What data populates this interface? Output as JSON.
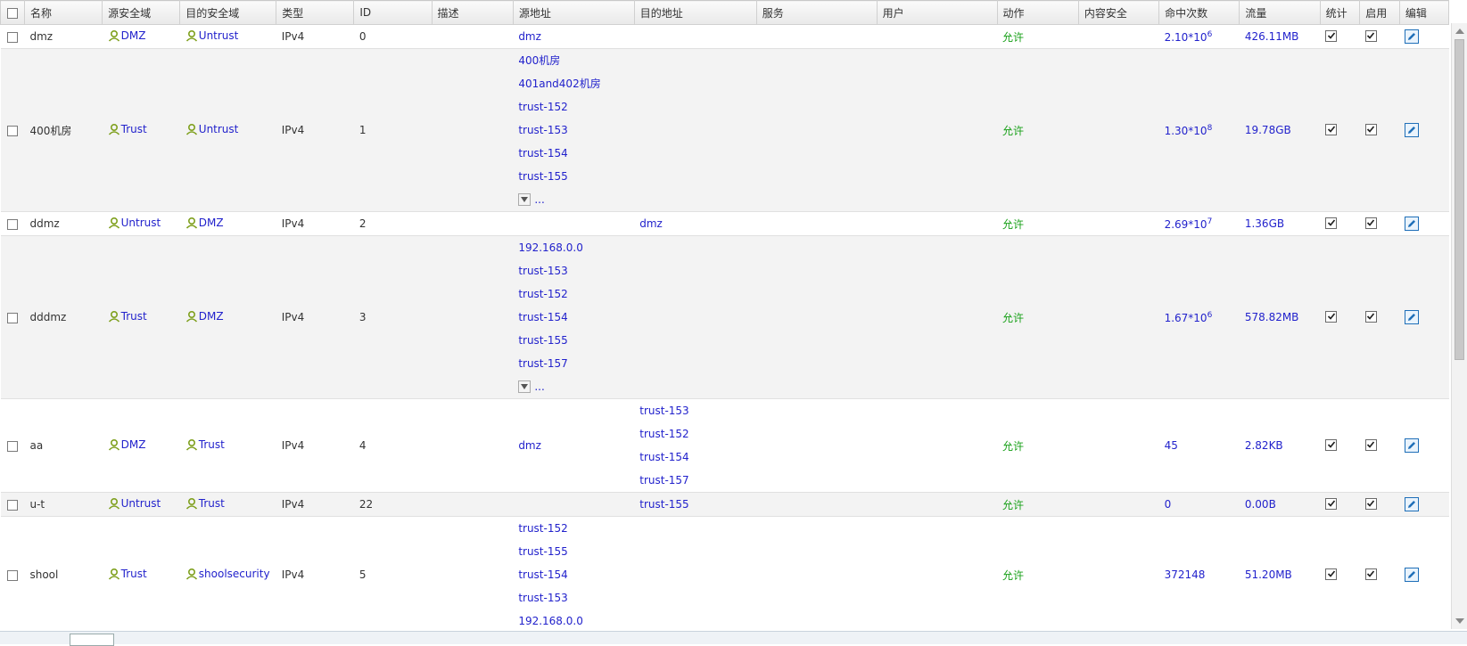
{
  "columns": {
    "name": "名称",
    "src_zone": "源安全域",
    "dst_zone": "目的安全域",
    "type": "类型",
    "id": "ID",
    "desc": "描述",
    "src_addr": "源地址",
    "dst_addr": "目的地址",
    "service": "服务",
    "user": "用户",
    "action": "动作",
    "content_security": "内容安全",
    "hits": "命中次数",
    "traffic": "流量",
    "stats": "统计",
    "enable": "启用",
    "edit": "编辑"
  },
  "rows": [
    {
      "name": "dmz",
      "src_zone": "DMZ",
      "dst_zone": "Untrust",
      "type": "IPv4",
      "id": "0",
      "src_addr": [
        "dmz"
      ],
      "src_more": false,
      "dst_addr": [],
      "action": "允许",
      "hits_base": "2.10*10",
      "hits_exp": "6",
      "traffic": "426.11MB",
      "stats": true,
      "enable": true
    },
    {
      "name": "400机房",
      "src_zone": "Trust",
      "dst_zone": "Untrust",
      "type": "IPv4",
      "id": "1",
      "src_addr": [
        "400机房",
        "401and402机房",
        "trust-152",
        "trust-153",
        "trust-154",
        "trust-155"
      ],
      "src_more": true,
      "dst_addr": [],
      "action": "允许",
      "hits_base": "1.30*10",
      "hits_exp": "8",
      "traffic": "19.78GB",
      "stats": true,
      "enable": true
    },
    {
      "name": "ddmz",
      "src_zone": "Untrust",
      "dst_zone": "DMZ",
      "type": "IPv4",
      "id": "2",
      "src_addr": [],
      "src_more": false,
      "dst_addr": [
        "dmz"
      ],
      "action": "允许",
      "hits_base": "2.69*10",
      "hits_exp": "7",
      "traffic": "1.36GB",
      "stats": true,
      "enable": true
    },
    {
      "name": "dddmz",
      "src_zone": "Trust",
      "dst_zone": "DMZ",
      "type": "IPv4",
      "id": "3",
      "src_addr": [
        "192.168.0.0",
        "trust-153",
        "trust-152",
        "trust-154",
        "trust-155",
        "trust-157"
      ],
      "src_more": true,
      "dst_addr": [],
      "action": "允许",
      "hits_base": "1.67*10",
      "hits_exp": "6",
      "traffic": "578.82MB",
      "stats": true,
      "enable": true
    },
    {
      "name": "aa",
      "src_zone": "DMZ",
      "dst_zone": "Trust",
      "type": "IPv4",
      "id": "4",
      "src_addr": [
        "dmz"
      ],
      "src_more": false,
      "dst_addr": [
        "trust-153",
        "trust-152",
        "trust-154",
        "trust-157"
      ],
      "action": "允许",
      "hits_base": "45",
      "hits_exp": "",
      "traffic": "2.82KB",
      "stats": true,
      "enable": true
    },
    {
      "name": "u-t",
      "src_zone": "Untrust",
      "dst_zone": "Trust",
      "type": "IPv4",
      "id": "22",
      "src_addr": [],
      "src_more": false,
      "dst_addr": [
        "trust-155"
      ],
      "action": "允许",
      "hits_base": "0",
      "hits_exp": "",
      "traffic": "0.00B",
      "stats": true,
      "enable": true
    },
    {
      "name": "shool",
      "src_zone": "Trust",
      "dst_zone": "shoolsecurity",
      "type": "IPv4",
      "id": "5",
      "src_addr": [
        "trust-152",
        "trust-155",
        "trust-154",
        "trust-153",
        "192.168.0.0"
      ],
      "src_more": false,
      "dst_addr": [],
      "action": "允许",
      "hits_base": "372148",
      "hits_exp": "",
      "traffic": "51.20MB",
      "stats": true,
      "enable": true
    }
  ],
  "icons": {
    "zone": "zone-user-icon",
    "edit": "edit-icon",
    "dropdown": "dropdown-arrow-icon",
    "checkbox": "checkbox-checked-icon"
  },
  "colors": {
    "link": "#2222cc",
    "action_allow": "#18a018",
    "header_bg": "#e9e9e9",
    "alt_row": "#f3f3f3"
  }
}
